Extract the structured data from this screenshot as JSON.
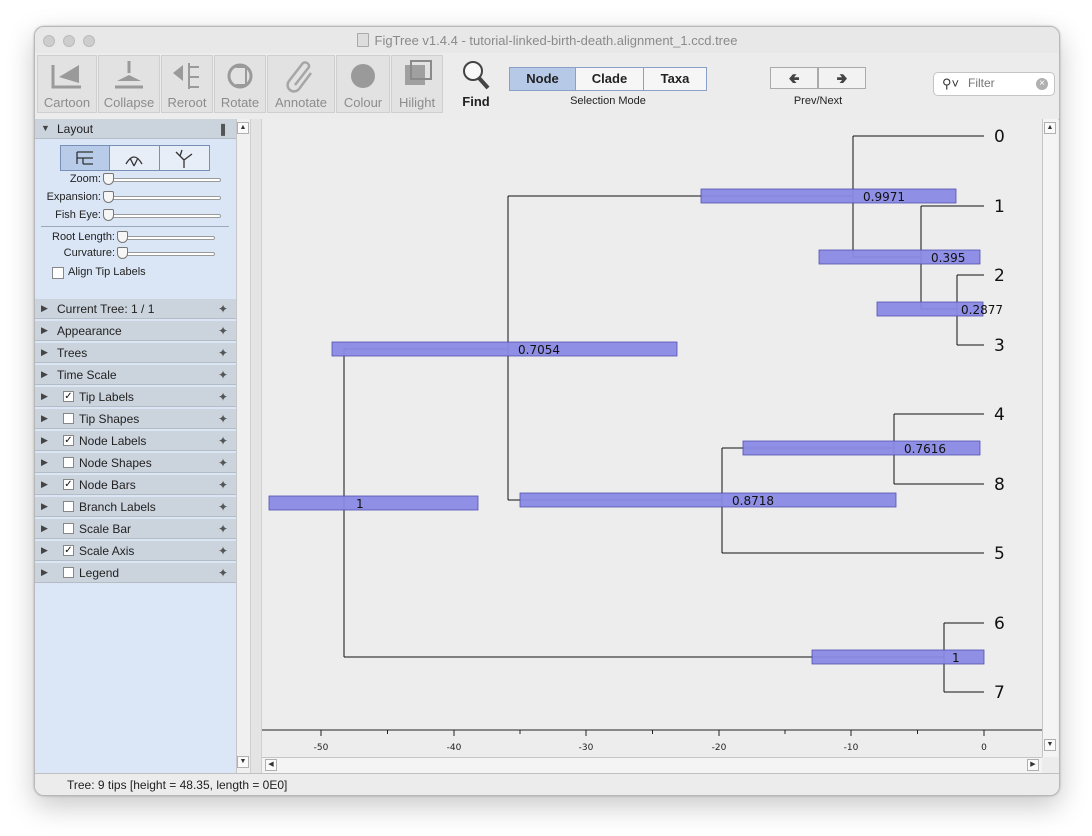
{
  "window": {
    "title": "FigTree v1.4.4 - tutorial-linked-birth-death.alignment_1.ccd.tree"
  },
  "toolbar": {
    "buttons": [
      {
        "label": "Cartoon",
        "icon": "cartoon-icon"
      },
      {
        "label": "Collapse",
        "icon": "collapse-icon"
      },
      {
        "label": "Reroot",
        "icon": "reroot-icon"
      },
      {
        "label": "Rotate",
        "icon": "rotate-icon"
      },
      {
        "label": "Annotate",
        "icon": "annotate-icon"
      },
      {
        "label": "Colour",
        "icon": "colour-icon"
      },
      {
        "label": "Hilight",
        "icon": "hilight-icon"
      }
    ],
    "find_label": "Find",
    "selection_mode": {
      "label": "Selection Mode",
      "options": [
        "Node",
        "Clade",
        "Taxa"
      ],
      "selected": "Node"
    },
    "prev_next_label": "Prev/Next",
    "filter_placeholder": "Filter"
  },
  "sidebar": {
    "layout": {
      "title": "Layout",
      "sliders": {
        "zoom": "Zoom:",
        "expansion": "Expansion:",
        "fish_eye": "Fish Eye:",
        "root_length": "Root Length:",
        "curvature": "Curvature:"
      },
      "align_tip_labels": "Align Tip Labels"
    },
    "panels": [
      {
        "label": "Current Tree: 1 / 1"
      },
      {
        "label": "Appearance"
      },
      {
        "label": "Trees"
      },
      {
        "label": "Time Scale"
      },
      {
        "label": "Tip Labels",
        "checked": true
      },
      {
        "label": "Tip Shapes",
        "checked": false
      },
      {
        "label": "Node Labels",
        "checked": true
      },
      {
        "label": "Node Shapes",
        "checked": false
      },
      {
        "label": "Node Bars",
        "checked": true
      },
      {
        "label": "Branch Labels",
        "checked": false
      },
      {
        "label": "Scale Bar",
        "checked": false
      },
      {
        "label": "Scale Axis",
        "checked": true
      },
      {
        "label": "Legend",
        "checked": false
      }
    ]
  },
  "status": "Tree: 9 tips [height = 48.35, length = 0E0]",
  "tree": {
    "tips": [
      "0",
      "1",
      "2",
      "3",
      "4",
      "8",
      "5",
      "6",
      "7"
    ],
    "node_labels": [
      "1",
      "0.7054",
      "0.9971",
      "0.395",
      "0.2877",
      "0.8718",
      "0.7616",
      "1"
    ],
    "axis_ticks": [
      "-50",
      "-40",
      "-30",
      "-20",
      "-10",
      "0"
    ],
    "bar_color": "#8a8ae6"
  }
}
